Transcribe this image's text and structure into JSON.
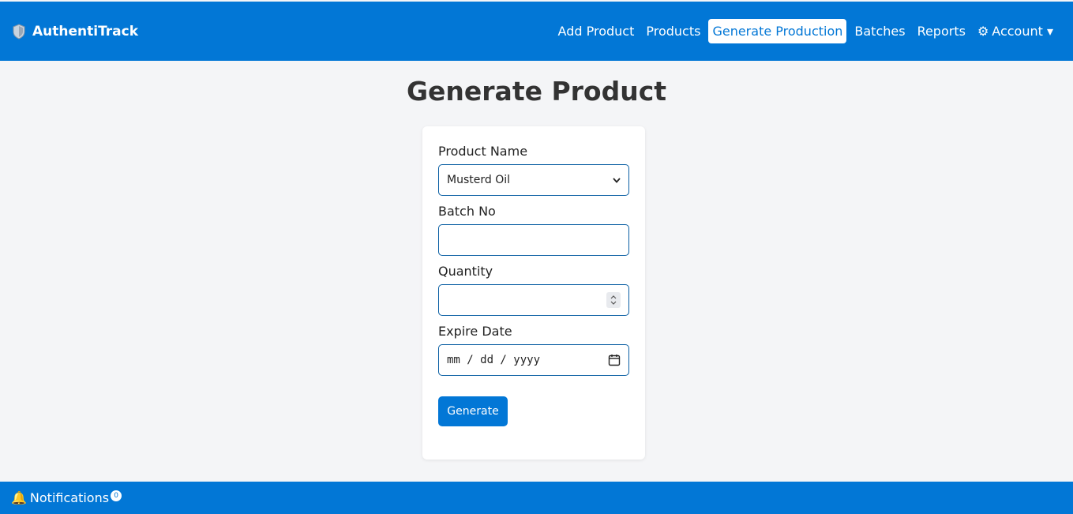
{
  "nav": {
    "brand": "AuthentiTrack",
    "brand_icon": "shield-icon",
    "links": [
      {
        "label": "Add Product"
      },
      {
        "label": "Products"
      },
      {
        "label": "Generate Production",
        "active": true
      },
      {
        "label": "Batches"
      },
      {
        "label": "Reports"
      },
      {
        "label": "Account ▾",
        "icon": "gear-icon"
      }
    ]
  },
  "page": {
    "title": "Generate Product"
  },
  "form": {
    "product_name_label": "Product Name",
    "product_name_value": "Musterd Oil",
    "batch_no_label": "Batch No",
    "batch_no_value": "",
    "quantity_label": "Quantity",
    "quantity_value": "",
    "expire_date_label": "Expire Date",
    "expire_date_placeholder": "mm / dd / yyyy",
    "submit_label": "Generate"
  },
  "footer": {
    "notifications_label": "Notifications",
    "notifications_count": "0",
    "icon": "bell-icon"
  },
  "colors": {
    "primary": "#0277d6",
    "background": "#f4f5f7"
  }
}
